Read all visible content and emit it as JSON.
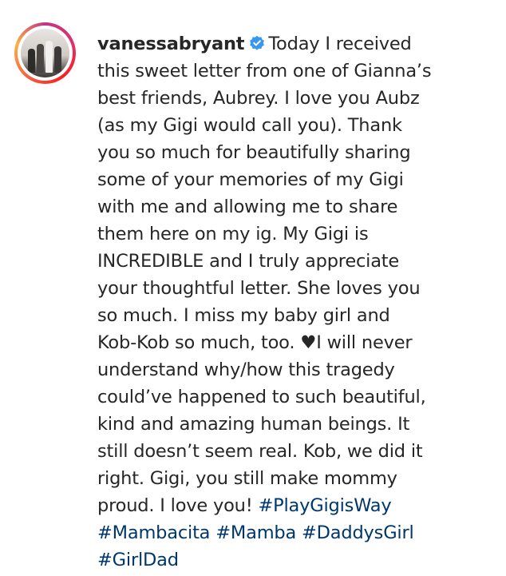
{
  "post": {
    "username": "vanessabryant",
    "verified_icon": "verified-badge-icon",
    "accent_color": "#3897f0",
    "hashtag_color": "#00376b",
    "caption_lines": [
      "Today I received",
      "this sweet letter from one of Gianna’s",
      "best friends, Aubrey. I love you Aubz",
      "(as my Gigi would call you). Thank",
      "you so much for beautifully sharing",
      "some of your memories of my Gigi",
      "with me and allowing me to share",
      "them here on my ig. My Gigi is",
      "INCREDIBLE and I truly appreciate",
      "your thoughtful letter. She loves you",
      "so much. I miss my baby girl and",
      "Kob-Kob so much, too. ♥I will never",
      "understand why/how this tragedy",
      "could’ve happened to such beautiful,",
      "kind and amazing human beings. It",
      "still doesn’t seem real. Kob, we did it",
      "right. Gigi, you still make mommy",
      "proud. I love you!"
    ],
    "hashtags": {
      "playgigisway": "#PlayGigisWay",
      "mambacita": "#Mambacita",
      "mamba": "#Mamba",
      "daddysgirl": "#DaddysGirl",
      "girldad": "#GirlDad"
    }
  }
}
